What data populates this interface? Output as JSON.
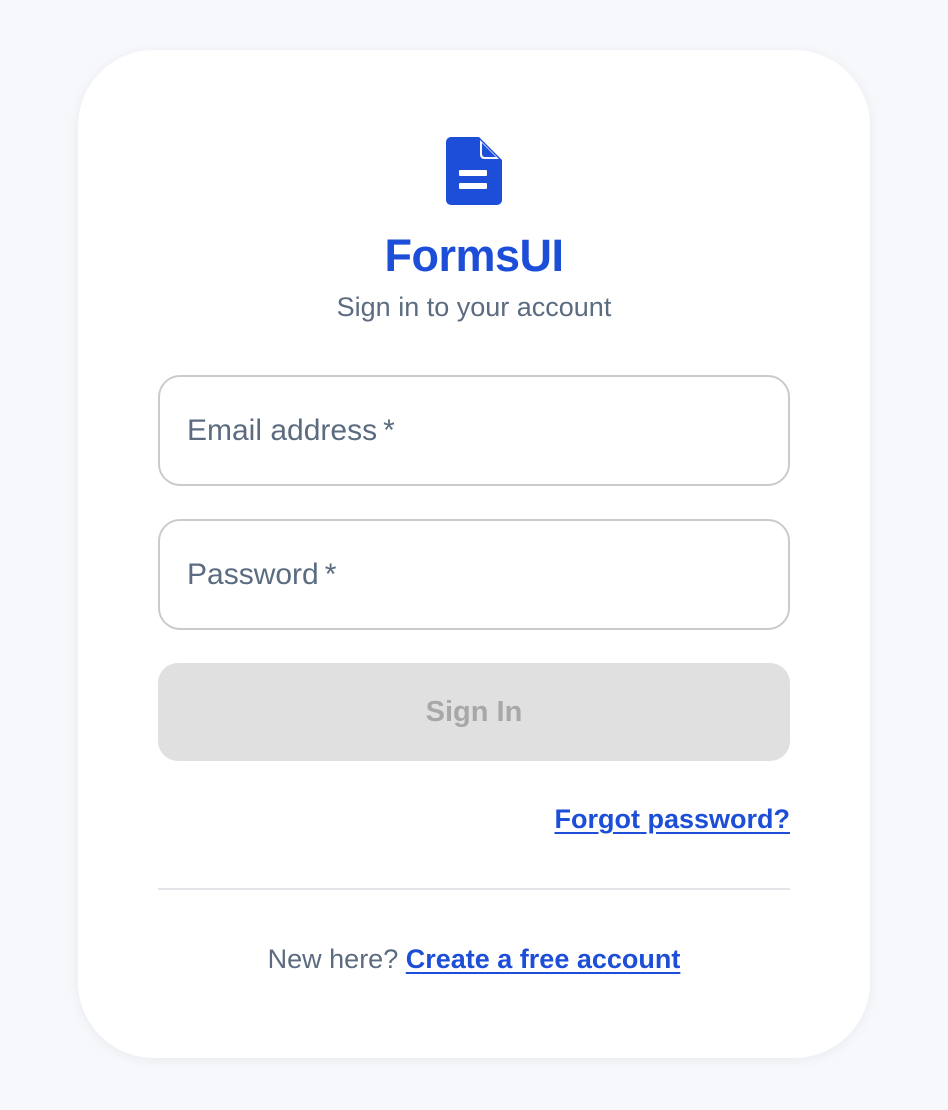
{
  "brand": {
    "name": "FormsUI",
    "logo_icon": "document-icon",
    "color": "#1d4ed8"
  },
  "header": {
    "subtitle": "Sign in to your account"
  },
  "form": {
    "email": {
      "label": "Email address",
      "required_marker": "*",
      "value": ""
    },
    "password": {
      "label": "Password",
      "required_marker": "*",
      "value": ""
    },
    "submit_label": "Sign In",
    "submit_state": "disabled"
  },
  "links": {
    "forgot_password": "Forgot password?",
    "signup_prompt": "New here?",
    "signup_link": "Create a free account"
  },
  "colors": {
    "accent": "#1d4ed8",
    "muted_text": "#5b6b80",
    "disabled_button_bg": "#e0e0e0",
    "disabled_button_text": "#a8a8a8"
  }
}
